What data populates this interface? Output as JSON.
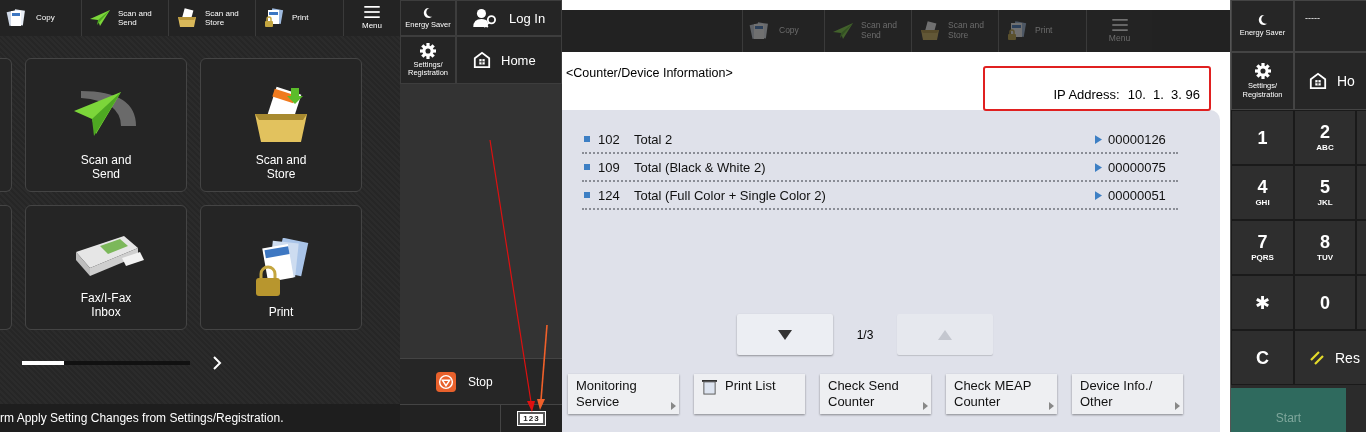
{
  "home_screen": {
    "function_bar": [
      {
        "kind": "copy",
        "label": "Copy"
      },
      {
        "kind": "send",
        "label": "Scan and\nSend"
      },
      {
        "kind": "store",
        "label": "Scan and\nStore"
      },
      {
        "kind": "print",
        "label": "Print"
      },
      {
        "kind": "menu",
        "label": "Menu"
      }
    ],
    "tiles": [
      {
        "kind": "send",
        "label": "Scan and\nSend"
      },
      {
        "kind": "store",
        "label": "Scan and\nStore"
      },
      {
        "kind": "fax",
        "label": "Fax/I-Fax\nInbox"
      },
      {
        "kind": "print",
        "label": "Print"
      }
    ],
    "page_scroll": {
      "level": 0.25
    },
    "status_message": "rm Apply Setting Changes from Settings/Registration.",
    "side": {
      "energy_saver": "Energy Saver",
      "log_in": "Log In",
      "settings": "Settings/\nRegistration",
      "home": "Home",
      "stop": "Stop",
      "input_mode": "123"
    }
  },
  "counter_screen": {
    "function_bar": [
      {
        "kind": "copy",
        "label": "Copy"
      },
      {
        "kind": "send",
        "label": "Scan and\nSend"
      },
      {
        "kind": "store",
        "label": "Scan and\nStore"
      },
      {
        "kind": "print",
        "label": "Print"
      },
      {
        "kind": "menu",
        "label": "Menu"
      }
    ],
    "title": "<Counter/Device Information>",
    "ip_label": "IP Address:",
    "ip_value": "10.  1.  3. 96",
    "counters": [
      {
        "number": "102",
        "name": "Total 2",
        "value": "00000126"
      },
      {
        "number": "109",
        "name": "Total (Black & White 2)",
        "value": "00000075"
      },
      {
        "number": "124",
        "name": "Total (Full Color + Single Color 2)",
        "value": "00000051"
      }
    ],
    "pager": {
      "page": "1/3",
      "down_disabled": false,
      "up_disabled": true
    },
    "buttons": [
      {
        "kind": "more",
        "label": "Monitoring\nService"
      },
      {
        "kind": "list",
        "label": "Print List"
      },
      {
        "kind": "more",
        "label": "Check Send\nCounter"
      },
      {
        "kind": "more",
        "label": "Check MEAP\nCounter"
      },
      {
        "kind": "more",
        "label": "Device Info./\nOther"
      }
    ]
  },
  "control_panel": {
    "energy_saver": "Energy Saver",
    "user": "-----",
    "settings": "Settings/\nRegistration",
    "home": "Ho",
    "keys": [
      {
        "kind": "key",
        "main": "1"
      },
      {
        "kind": "key",
        "main": "2",
        "letters": "ABC"
      },
      {
        "kind": "key",
        "main": "4",
        "letters": "GHI"
      },
      {
        "kind": "key",
        "main": "5",
        "letters": "JKL"
      },
      {
        "kind": "key",
        "main": "7",
        "letters": "PQRS"
      },
      {
        "kind": "key",
        "main": "8",
        "letters": "TUV"
      },
      {
        "kind": "key",
        "main": "✱"
      },
      {
        "kind": "key",
        "main": "0"
      },
      {
        "kind": "key",
        "main": "C"
      },
      {
        "kind": "reset",
        "main": "Res"
      }
    ],
    "start": "Start"
  }
}
